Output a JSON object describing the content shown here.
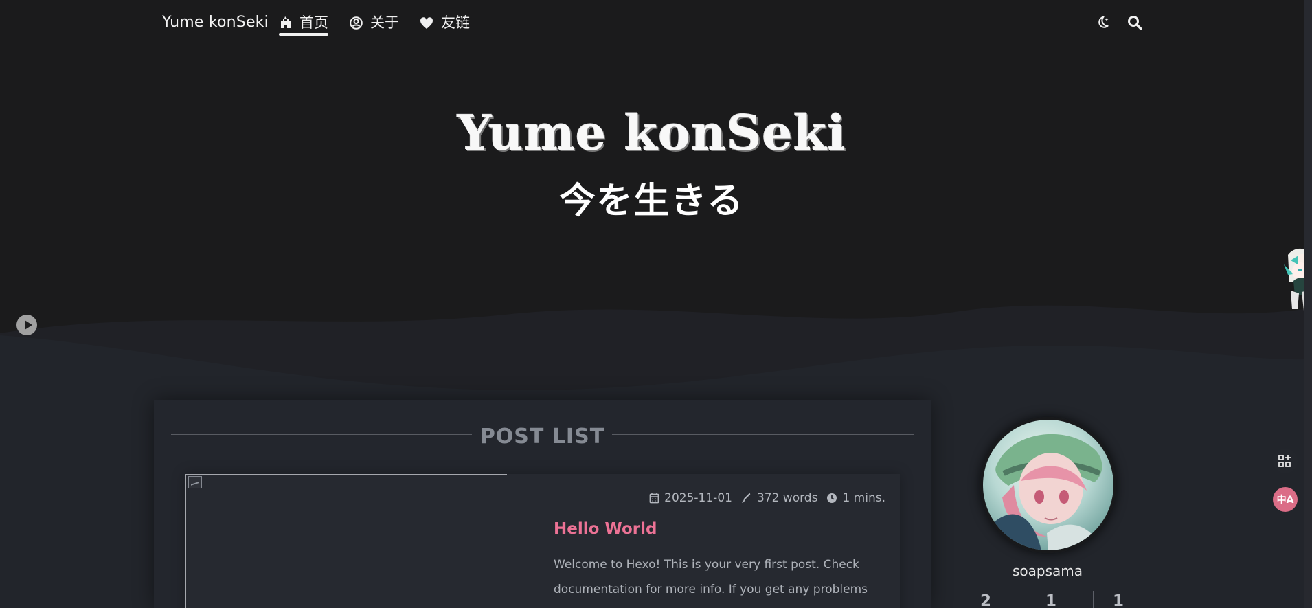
{
  "nav": {
    "site_title": "Yume konSeki",
    "items": [
      {
        "label": "首页",
        "icon": "castle-icon",
        "active": true
      },
      {
        "label": "关于",
        "icon": "user-circle-icon"
      },
      {
        "label": "友链",
        "icon": "heart-icon"
      }
    ],
    "right_icons": [
      "moon-icon",
      "search-icon"
    ]
  },
  "hero": {
    "title": "Yume konSeki",
    "subtitle": "今を生きる"
  },
  "media": {
    "play_icon": "play-icon"
  },
  "main": {
    "post_list_heading": "POST LIST",
    "posts": [
      {
        "date": "2025-11-01",
        "words": "372 words",
        "reading_time": "1 mins.",
        "title": "Hello World",
        "excerpt": "Welcome to Hexo! This is your very first post. Check documentation for more info. If you get any problems when"
      }
    ]
  },
  "profile": {
    "name": "soapsama",
    "stats": [
      "2",
      "1",
      "1"
    ]
  },
  "side_actions": {
    "add_icon": "widget-add-icon",
    "translate_label": "中A"
  },
  "colors": {
    "background": "#1b1b1c",
    "main_background": "#22252b",
    "accent": "#ec7295",
    "text_primary": "#f1f1f1",
    "text_secondary": "#aeb2b9"
  }
}
